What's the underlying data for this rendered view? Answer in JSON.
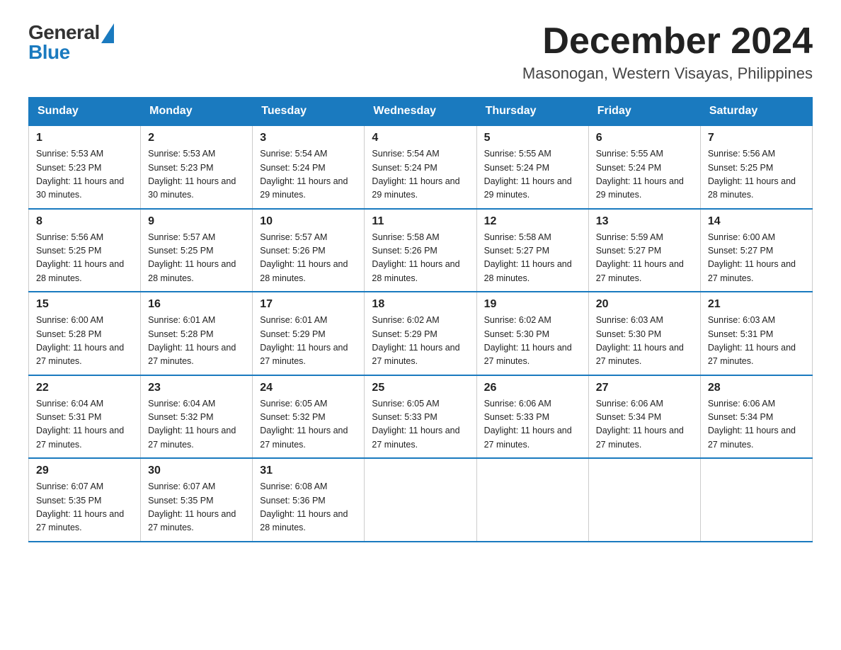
{
  "header": {
    "logo_general": "General",
    "logo_blue": "Blue",
    "month_title": "December 2024",
    "location": "Masonogan, Western Visayas, Philippines"
  },
  "days_of_week": [
    "Sunday",
    "Monday",
    "Tuesday",
    "Wednesday",
    "Thursday",
    "Friday",
    "Saturday"
  ],
  "weeks": [
    [
      {
        "day": "1",
        "sunrise": "5:53 AM",
        "sunset": "5:23 PM",
        "daylight": "11 hours and 30 minutes."
      },
      {
        "day": "2",
        "sunrise": "5:53 AM",
        "sunset": "5:23 PM",
        "daylight": "11 hours and 30 minutes."
      },
      {
        "day": "3",
        "sunrise": "5:54 AM",
        "sunset": "5:24 PM",
        "daylight": "11 hours and 29 minutes."
      },
      {
        "day": "4",
        "sunrise": "5:54 AM",
        "sunset": "5:24 PM",
        "daylight": "11 hours and 29 minutes."
      },
      {
        "day": "5",
        "sunrise": "5:55 AM",
        "sunset": "5:24 PM",
        "daylight": "11 hours and 29 minutes."
      },
      {
        "day": "6",
        "sunrise": "5:55 AM",
        "sunset": "5:24 PM",
        "daylight": "11 hours and 29 minutes."
      },
      {
        "day": "7",
        "sunrise": "5:56 AM",
        "sunset": "5:25 PM",
        "daylight": "11 hours and 28 minutes."
      }
    ],
    [
      {
        "day": "8",
        "sunrise": "5:56 AM",
        "sunset": "5:25 PM",
        "daylight": "11 hours and 28 minutes."
      },
      {
        "day": "9",
        "sunrise": "5:57 AM",
        "sunset": "5:25 PM",
        "daylight": "11 hours and 28 minutes."
      },
      {
        "day": "10",
        "sunrise": "5:57 AM",
        "sunset": "5:26 PM",
        "daylight": "11 hours and 28 minutes."
      },
      {
        "day": "11",
        "sunrise": "5:58 AM",
        "sunset": "5:26 PM",
        "daylight": "11 hours and 28 minutes."
      },
      {
        "day": "12",
        "sunrise": "5:58 AM",
        "sunset": "5:27 PM",
        "daylight": "11 hours and 28 minutes."
      },
      {
        "day": "13",
        "sunrise": "5:59 AM",
        "sunset": "5:27 PM",
        "daylight": "11 hours and 27 minutes."
      },
      {
        "day": "14",
        "sunrise": "6:00 AM",
        "sunset": "5:27 PM",
        "daylight": "11 hours and 27 minutes."
      }
    ],
    [
      {
        "day": "15",
        "sunrise": "6:00 AM",
        "sunset": "5:28 PM",
        "daylight": "11 hours and 27 minutes."
      },
      {
        "day": "16",
        "sunrise": "6:01 AM",
        "sunset": "5:28 PM",
        "daylight": "11 hours and 27 minutes."
      },
      {
        "day": "17",
        "sunrise": "6:01 AM",
        "sunset": "5:29 PM",
        "daylight": "11 hours and 27 minutes."
      },
      {
        "day": "18",
        "sunrise": "6:02 AM",
        "sunset": "5:29 PM",
        "daylight": "11 hours and 27 minutes."
      },
      {
        "day": "19",
        "sunrise": "6:02 AM",
        "sunset": "5:30 PM",
        "daylight": "11 hours and 27 minutes."
      },
      {
        "day": "20",
        "sunrise": "6:03 AM",
        "sunset": "5:30 PM",
        "daylight": "11 hours and 27 minutes."
      },
      {
        "day": "21",
        "sunrise": "6:03 AM",
        "sunset": "5:31 PM",
        "daylight": "11 hours and 27 minutes."
      }
    ],
    [
      {
        "day": "22",
        "sunrise": "6:04 AM",
        "sunset": "5:31 PM",
        "daylight": "11 hours and 27 minutes."
      },
      {
        "day": "23",
        "sunrise": "6:04 AM",
        "sunset": "5:32 PM",
        "daylight": "11 hours and 27 minutes."
      },
      {
        "day": "24",
        "sunrise": "6:05 AM",
        "sunset": "5:32 PM",
        "daylight": "11 hours and 27 minutes."
      },
      {
        "day": "25",
        "sunrise": "6:05 AM",
        "sunset": "5:33 PM",
        "daylight": "11 hours and 27 minutes."
      },
      {
        "day": "26",
        "sunrise": "6:06 AM",
        "sunset": "5:33 PM",
        "daylight": "11 hours and 27 minutes."
      },
      {
        "day": "27",
        "sunrise": "6:06 AM",
        "sunset": "5:34 PM",
        "daylight": "11 hours and 27 minutes."
      },
      {
        "day": "28",
        "sunrise": "6:06 AM",
        "sunset": "5:34 PM",
        "daylight": "11 hours and 27 minutes."
      }
    ],
    [
      {
        "day": "29",
        "sunrise": "6:07 AM",
        "sunset": "5:35 PM",
        "daylight": "11 hours and 27 minutes."
      },
      {
        "day": "30",
        "sunrise": "6:07 AM",
        "sunset": "5:35 PM",
        "daylight": "11 hours and 27 minutes."
      },
      {
        "day": "31",
        "sunrise": "6:08 AM",
        "sunset": "5:36 PM",
        "daylight": "11 hours and 28 minutes."
      },
      null,
      null,
      null,
      null
    ]
  ]
}
